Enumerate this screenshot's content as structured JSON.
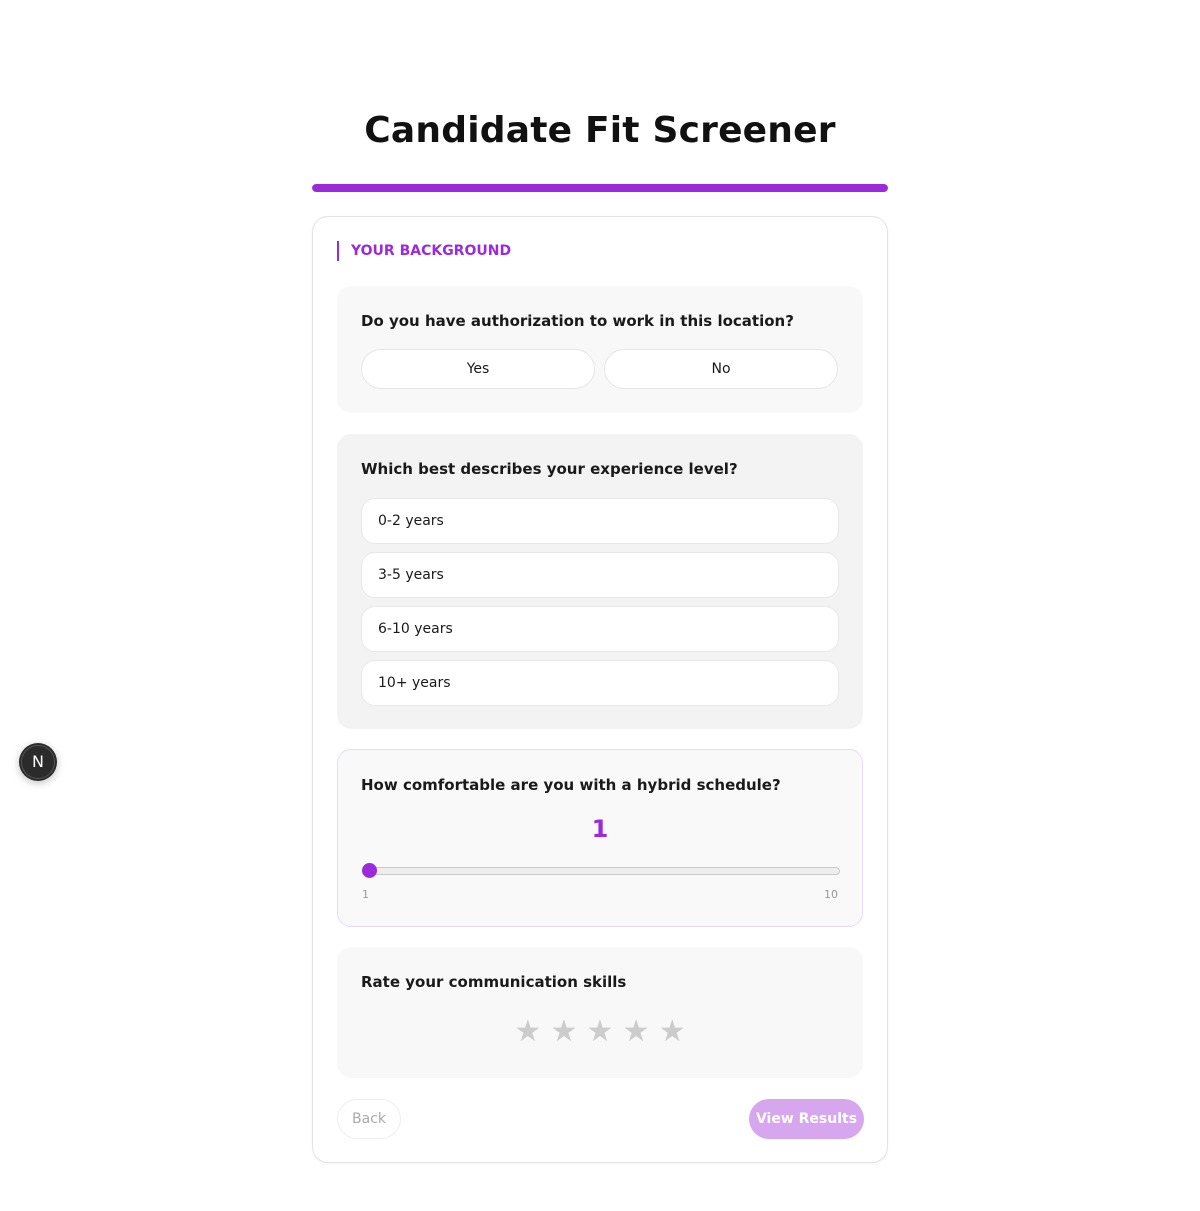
{
  "page": {
    "title": "Candidate Fit Screener"
  },
  "progress": {
    "fraction": 1.0,
    "color": "#9b2bd8"
  },
  "section": {
    "label": "YOUR BACKGROUND"
  },
  "questions": {
    "authorization": {
      "text": "Do you have authorization to work in this location?",
      "options": [
        "Yes",
        "No"
      ]
    },
    "experience": {
      "text": "Which best describes your experience level?",
      "options": [
        "0-2 years",
        "3-5 years",
        "6-10 years",
        "10+ years"
      ]
    },
    "hybrid": {
      "text": "How comfortable are you with a hybrid schedule?",
      "value": "1",
      "min": "1",
      "max": "10"
    },
    "communication": {
      "text": "Rate your communication skills",
      "stars": [
        "★",
        "★",
        "★",
        "★",
        "★"
      ],
      "rating": 0
    }
  },
  "footer": {
    "back_label": "Back",
    "results_label": "View Results"
  },
  "badge": {
    "letter": "N"
  },
  "colors": {
    "accent": "#9b2bd8",
    "accent_disabled": "#d6a6ef",
    "star_inactive": "#cccccc"
  }
}
